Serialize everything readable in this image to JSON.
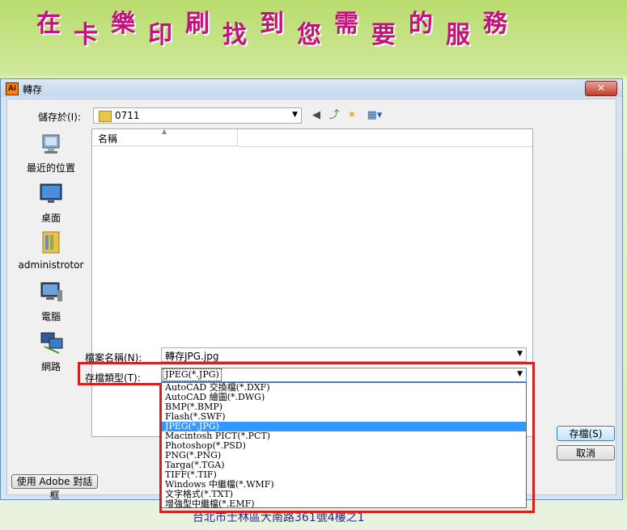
{
  "background": {
    "banner_chars": [
      "在",
      "卡",
      "樂",
      "印",
      "刷",
      "找",
      "到",
      "您",
      "需",
      "要",
      "的",
      "服",
      "務"
    ],
    "address": "台北市士林區大南路361號4樓之1"
  },
  "window": {
    "title": "轉存",
    "close_label": "✕",
    "app_icon_label": "Ai"
  },
  "toolbar": {
    "save_in_label": "儲存於(I):",
    "save_in_value": "0711",
    "icons": [
      "back-icon",
      "up-folder-icon",
      "new-folder-icon",
      "view-menu-icon"
    ]
  },
  "places": [
    {
      "label": "最近的位置",
      "icon": "recent-places-icon"
    },
    {
      "label": "桌面",
      "icon": "desktop-icon"
    },
    {
      "label": "administrotor",
      "icon": "user-folder-icon"
    },
    {
      "label": "電腦",
      "icon": "computer-icon"
    },
    {
      "label": "網路",
      "icon": "network-icon"
    }
  ],
  "file_list": {
    "column_name": "名稱"
  },
  "form": {
    "filename_label": "檔案名稱(N):",
    "filename_value": "轉存JPG.jpg",
    "filetype_label": "存檔類型(T):",
    "filetype_value": "JPEG(*.JPG)"
  },
  "buttons": {
    "save": "存檔(S)",
    "cancel": "取消",
    "adobe_dialog": "使用 Adobe 對話框"
  },
  "filetype_options": [
    "AutoCAD 交換檔(*.DXF)",
    "AutoCAD 繪圖(*.DWG)",
    "BMP(*.BMP)",
    "Flash(*.SWF)",
    "JPEG(*.JPG)",
    "Macintosh PICT(*.PCT)",
    "Photoshop(*.PSD)",
    "PNG(*.PNG)",
    "Targa(*.TGA)",
    "TIFF(*.TIF)",
    "Windows 中繼檔(*.WMF)",
    "文字格式(*.TXT)",
    "增強型中繼檔(*.EMF)"
  ],
  "selected_option": "JPEG(*.JPG)",
  "colors": {
    "highlight_box": "#d62020",
    "selection": "#3399ff"
  }
}
